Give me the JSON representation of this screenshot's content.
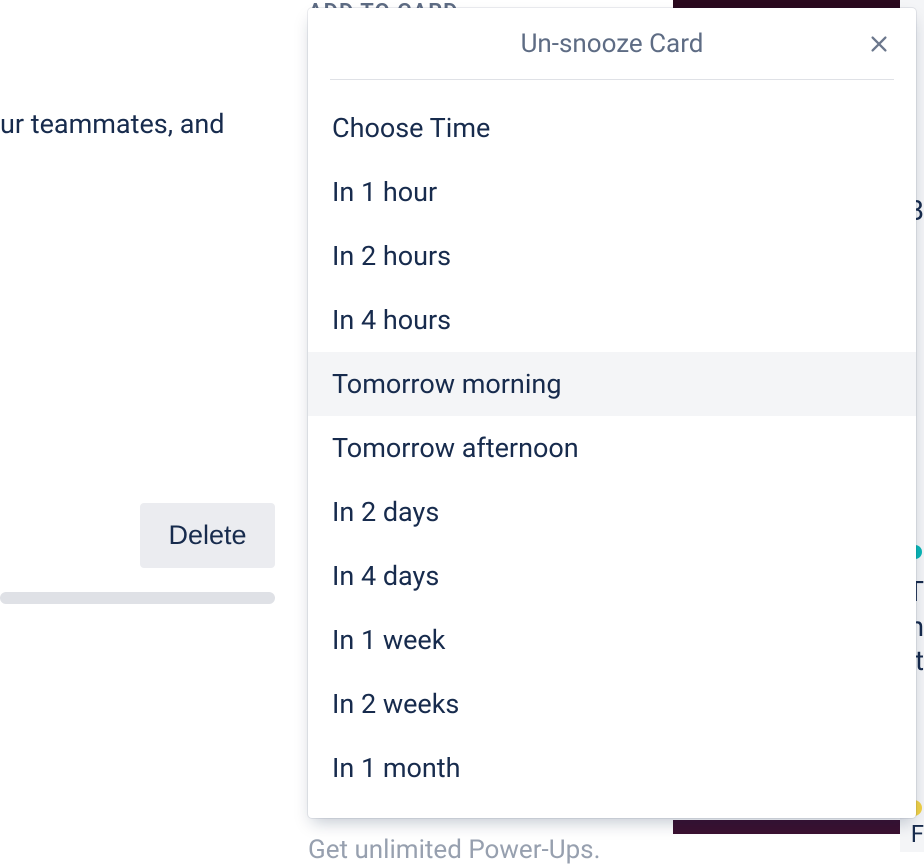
{
  "background": {
    "add_to_card_label": "ADD TO CARD",
    "teammates_text": "ur teammates, and",
    "delete_label": "Delete",
    "powerups_text": "Get unlimited Power-Ups."
  },
  "popover": {
    "title": "Un-snooze Card",
    "options": [
      {
        "label": "Choose Time",
        "highlighted": false
      },
      {
        "label": "In 1 hour",
        "highlighted": false
      },
      {
        "label": "In 2 hours",
        "highlighted": false
      },
      {
        "label": "In 4 hours",
        "highlighted": false
      },
      {
        "label": "Tomorrow morning",
        "highlighted": true
      },
      {
        "label": "Tomorrow afternoon",
        "highlighted": false
      },
      {
        "label": "In 2 days",
        "highlighted": false
      },
      {
        "label": "In 4 days",
        "highlighted": false
      },
      {
        "label": "In 1 week",
        "highlighted": false
      },
      {
        "label": "In 2 weeks",
        "highlighted": false
      },
      {
        "label": "In 1 month",
        "highlighted": false
      }
    ]
  },
  "right_edge": {
    "b": "B",
    "t": "T",
    "h": "h",
    "t2": "t",
    "f": "F"
  }
}
